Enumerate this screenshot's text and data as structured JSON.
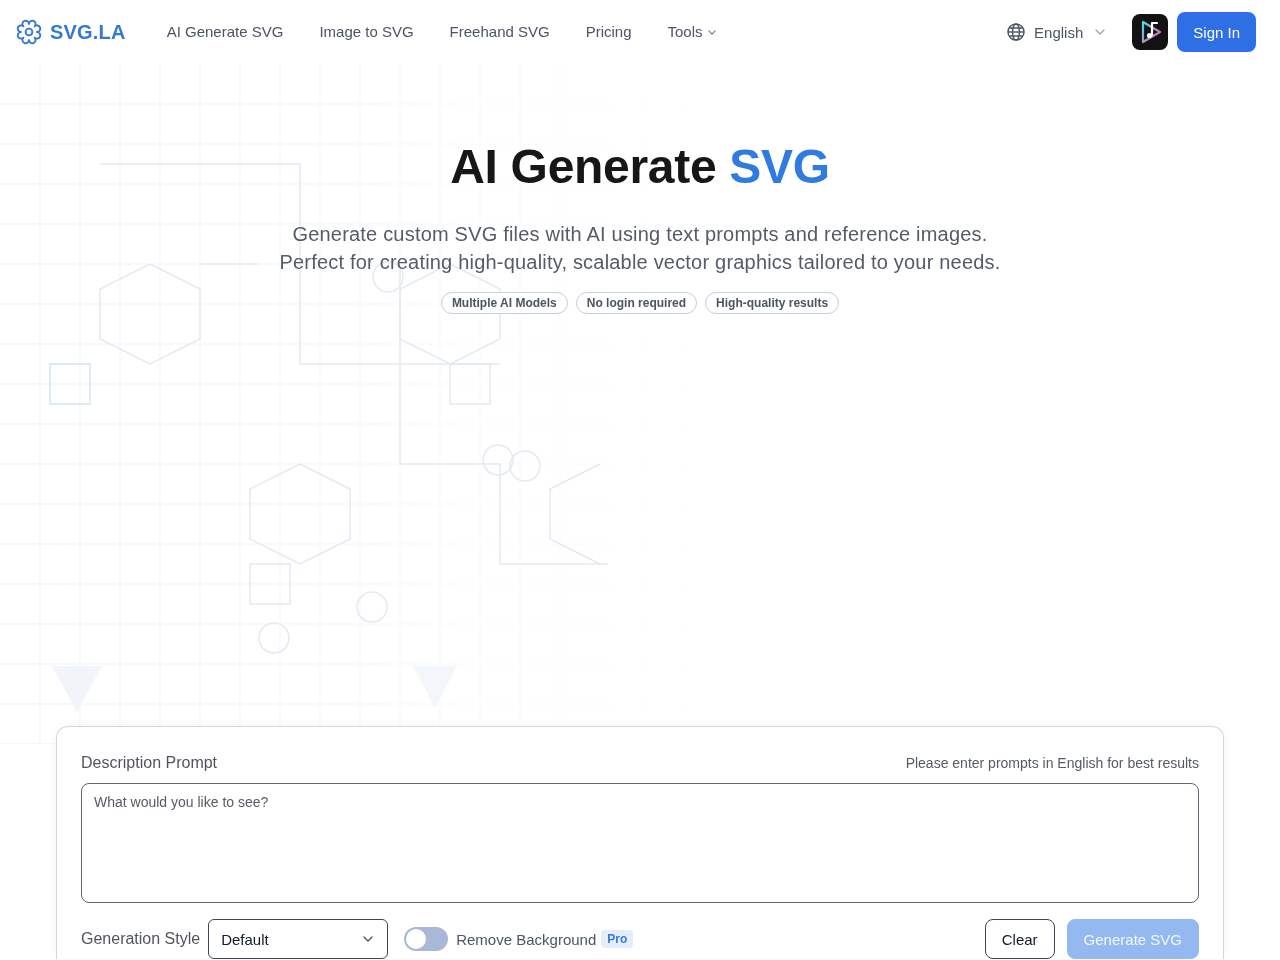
{
  "header": {
    "logo": "SVG.LA",
    "nav": [
      {
        "label": "AI Generate SVG",
        "kind": "link"
      },
      {
        "label": "Image to SVG",
        "kind": "link"
      },
      {
        "label": "Freehand SVG",
        "kind": "link"
      },
      {
        "label": "Pricing",
        "kind": "link"
      },
      {
        "label": "Tools",
        "kind": "dropdown"
      }
    ],
    "language": "English",
    "sign_in": "Sign In"
  },
  "hero": {
    "title": "AI Generate",
    "title_accent": "SVG",
    "subtitle": [
      "Generate custom SVG files with AI using text prompts and reference images.",
      "Perfect for creating high-quality, scalable vector graphics tailored to your needs."
    ],
    "tags": [
      "Multiple AI Models",
      "No login required",
      "High-quality results"
    ]
  },
  "form": {
    "prompt_label": "Description Prompt",
    "prompt_hint": "Please enter prompts in English for best results",
    "prompt": {
      "placeholder": "What would you like to see?"
    },
    "style_label": "Generation Style",
    "style_select": {
      "value": "Default"
    },
    "remove_background": {
      "label": "Remove Background",
      "on": false,
      "badge": "Pro"
    },
    "buttons": [
      {
        "label": "Clear",
        "kind": "secondary",
        "disabled": false
      },
      {
        "label": "Generate SVG",
        "kind": "primary",
        "disabled": true
      }
    ]
  }
}
